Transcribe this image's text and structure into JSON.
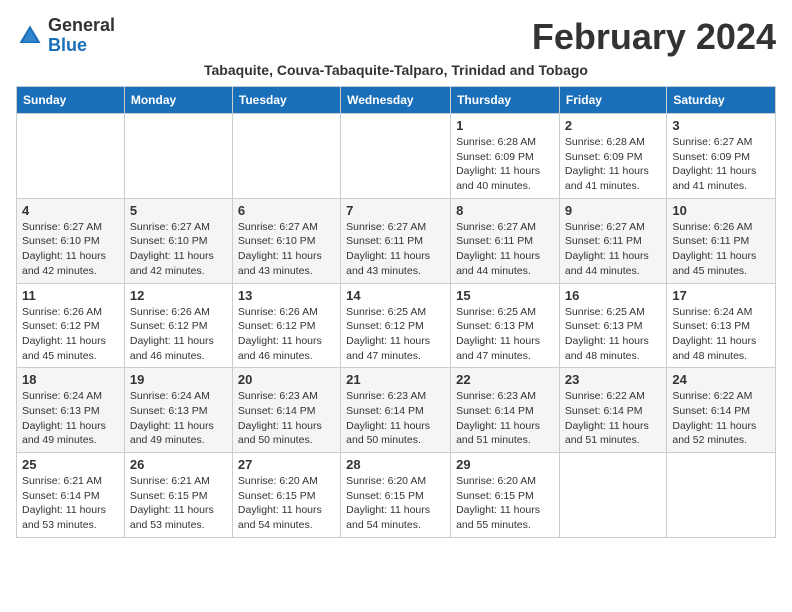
{
  "header": {
    "logo_general": "General",
    "logo_blue": "Blue",
    "month_title": "February 2024",
    "subtitle": "Tabaquite, Couva-Tabaquite-Talparo, Trinidad and Tobago"
  },
  "weekdays": [
    "Sunday",
    "Monday",
    "Tuesday",
    "Wednesday",
    "Thursday",
    "Friday",
    "Saturday"
  ],
  "weeks": [
    {
      "row_style": "row-white",
      "days": [
        {
          "num": "",
          "info": ""
        },
        {
          "num": "",
          "info": ""
        },
        {
          "num": "",
          "info": ""
        },
        {
          "num": "",
          "info": ""
        },
        {
          "num": "1",
          "info": "Sunrise: 6:28 AM\nSunset: 6:09 PM\nDaylight: 11 hours\nand 40 minutes."
        },
        {
          "num": "2",
          "info": "Sunrise: 6:28 AM\nSunset: 6:09 PM\nDaylight: 11 hours\nand 41 minutes."
        },
        {
          "num": "3",
          "info": "Sunrise: 6:27 AM\nSunset: 6:09 PM\nDaylight: 11 hours\nand 41 minutes."
        }
      ]
    },
    {
      "row_style": "row-gray",
      "days": [
        {
          "num": "4",
          "info": "Sunrise: 6:27 AM\nSunset: 6:10 PM\nDaylight: 11 hours\nand 42 minutes."
        },
        {
          "num": "5",
          "info": "Sunrise: 6:27 AM\nSunset: 6:10 PM\nDaylight: 11 hours\nand 42 minutes."
        },
        {
          "num": "6",
          "info": "Sunrise: 6:27 AM\nSunset: 6:10 PM\nDaylight: 11 hours\nand 43 minutes."
        },
        {
          "num": "7",
          "info": "Sunrise: 6:27 AM\nSunset: 6:11 PM\nDaylight: 11 hours\nand 43 minutes."
        },
        {
          "num": "8",
          "info": "Sunrise: 6:27 AM\nSunset: 6:11 PM\nDaylight: 11 hours\nand 44 minutes."
        },
        {
          "num": "9",
          "info": "Sunrise: 6:27 AM\nSunset: 6:11 PM\nDaylight: 11 hours\nand 44 minutes."
        },
        {
          "num": "10",
          "info": "Sunrise: 6:26 AM\nSunset: 6:11 PM\nDaylight: 11 hours\nand 45 minutes."
        }
      ]
    },
    {
      "row_style": "row-white",
      "days": [
        {
          "num": "11",
          "info": "Sunrise: 6:26 AM\nSunset: 6:12 PM\nDaylight: 11 hours\nand 45 minutes."
        },
        {
          "num": "12",
          "info": "Sunrise: 6:26 AM\nSunset: 6:12 PM\nDaylight: 11 hours\nand 46 minutes."
        },
        {
          "num": "13",
          "info": "Sunrise: 6:26 AM\nSunset: 6:12 PM\nDaylight: 11 hours\nand 46 minutes."
        },
        {
          "num": "14",
          "info": "Sunrise: 6:25 AM\nSunset: 6:12 PM\nDaylight: 11 hours\nand 47 minutes."
        },
        {
          "num": "15",
          "info": "Sunrise: 6:25 AM\nSunset: 6:13 PM\nDaylight: 11 hours\nand 47 minutes."
        },
        {
          "num": "16",
          "info": "Sunrise: 6:25 AM\nSunset: 6:13 PM\nDaylight: 11 hours\nand 48 minutes."
        },
        {
          "num": "17",
          "info": "Sunrise: 6:24 AM\nSunset: 6:13 PM\nDaylight: 11 hours\nand 48 minutes."
        }
      ]
    },
    {
      "row_style": "row-gray",
      "days": [
        {
          "num": "18",
          "info": "Sunrise: 6:24 AM\nSunset: 6:13 PM\nDaylight: 11 hours\nand 49 minutes."
        },
        {
          "num": "19",
          "info": "Sunrise: 6:24 AM\nSunset: 6:13 PM\nDaylight: 11 hours\nand 49 minutes."
        },
        {
          "num": "20",
          "info": "Sunrise: 6:23 AM\nSunset: 6:14 PM\nDaylight: 11 hours\nand 50 minutes."
        },
        {
          "num": "21",
          "info": "Sunrise: 6:23 AM\nSunset: 6:14 PM\nDaylight: 11 hours\nand 50 minutes."
        },
        {
          "num": "22",
          "info": "Sunrise: 6:23 AM\nSunset: 6:14 PM\nDaylight: 11 hours\nand 51 minutes."
        },
        {
          "num": "23",
          "info": "Sunrise: 6:22 AM\nSunset: 6:14 PM\nDaylight: 11 hours\nand 51 minutes."
        },
        {
          "num": "24",
          "info": "Sunrise: 6:22 AM\nSunset: 6:14 PM\nDaylight: 11 hours\nand 52 minutes."
        }
      ]
    },
    {
      "row_style": "row-white",
      "days": [
        {
          "num": "25",
          "info": "Sunrise: 6:21 AM\nSunset: 6:14 PM\nDaylight: 11 hours\nand 53 minutes."
        },
        {
          "num": "26",
          "info": "Sunrise: 6:21 AM\nSunset: 6:15 PM\nDaylight: 11 hours\nand 53 minutes."
        },
        {
          "num": "27",
          "info": "Sunrise: 6:20 AM\nSunset: 6:15 PM\nDaylight: 11 hours\nand 54 minutes."
        },
        {
          "num": "28",
          "info": "Sunrise: 6:20 AM\nSunset: 6:15 PM\nDaylight: 11 hours\nand 54 minutes."
        },
        {
          "num": "29",
          "info": "Sunrise: 6:20 AM\nSunset: 6:15 PM\nDaylight: 11 hours\nand 55 minutes."
        },
        {
          "num": "",
          "info": ""
        },
        {
          "num": "",
          "info": ""
        }
      ]
    }
  ]
}
